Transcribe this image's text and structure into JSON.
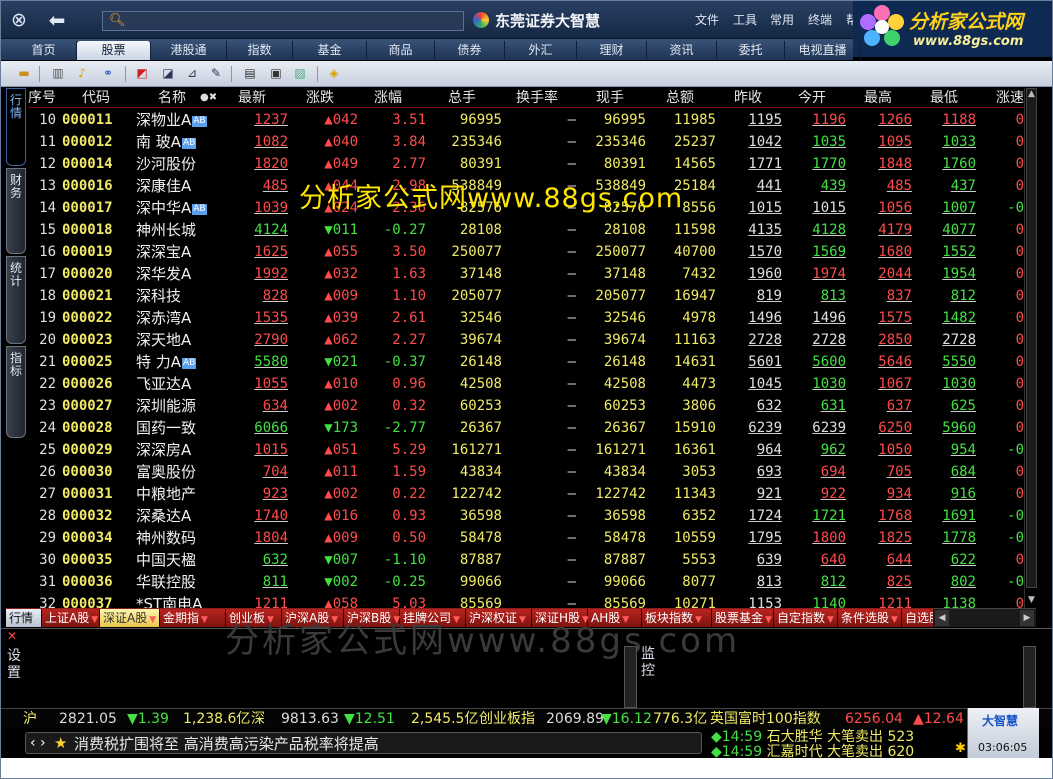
{
  "app": {
    "brand": "东莞证券大智慧",
    "search_placeholder": "",
    "menus": [
      "文件",
      "工具",
      "常用",
      "终端",
      "帮"
    ]
  },
  "watermark": {
    "logo_line1": "分析家公式网",
    "logo_line2": "www.88gs.com",
    "overlay": "分析家公式网www.88gs.com",
    "overlay2": "分析家公式网www.88gs.com"
  },
  "nav": [
    "首页",
    "股票",
    "港股通",
    "指数",
    "基金",
    "商品",
    "债券",
    "外汇",
    "理财",
    "资讯",
    "委托",
    "电视直播"
  ],
  "nav_active": 1,
  "toolbar_icons": [
    "folder-icon",
    "columns-icon",
    "bell-icon",
    "link-icon",
    "chart-icon",
    "line-chart-icon",
    "kline-icon",
    "pencil-chart-icon",
    "text-icon",
    "window-icon",
    "picture-icon",
    "help-icon"
  ],
  "left_tabs": [
    "行情",
    "财务",
    "统计",
    "指标"
  ],
  "columns": [
    "序号",
    "代码",
    "名称",
    "最新",
    "涨跌",
    "涨幅",
    "总手",
    "换手率",
    "现手",
    "总额",
    "昨收",
    "今开",
    "最高",
    "最低",
    "涨速"
  ],
  "rows": [
    {
      "no": "10",
      "code": "000011",
      "name": "深物业A",
      "ab": true,
      "last": "1237",
      "lc": "up",
      "chg": "▲042",
      "cc": "up",
      "pct": "3.51",
      "pc": "up",
      "vol": "96995",
      "turn": "–",
      "cur": "96995",
      "amt": "11985",
      "prev": "1195",
      "open": "1196",
      "oc": "up",
      "high": "1266",
      "hc": "up",
      "low": "1188",
      "lwc": "up",
      "spd": "0",
      "sc": "up"
    },
    {
      "no": "11",
      "code": "000012",
      "name": "南 玻A",
      "ab": true,
      "last": "1082",
      "lc": "up",
      "chg": "▲040",
      "cc": "up",
      "pct": "3.84",
      "pc": "up",
      "vol": "235346",
      "turn": "–",
      "cur": "235346",
      "amt": "25237",
      "prev": "1042",
      "open": "1035",
      "oc": "dn",
      "high": "1095",
      "hc": "up",
      "low": "1033",
      "lwc": "dn",
      "spd": "0",
      "sc": "up"
    },
    {
      "no": "12",
      "code": "000014",
      "name": "沙河股份",
      "ab": false,
      "last": "1820",
      "lc": "up",
      "chg": "▲049",
      "cc": "up",
      "pct": "2.77",
      "pc": "up",
      "vol": "80391",
      "turn": "–",
      "cur": "80391",
      "amt": "14565",
      "prev": "1771",
      "open": "1770",
      "oc": "dn",
      "high": "1848",
      "hc": "up",
      "low": "1760",
      "lwc": "dn",
      "spd": "0",
      "sc": "up"
    },
    {
      "no": "13",
      "code": "000016",
      "name": "深康佳A",
      "ab": false,
      "last": "485",
      "lc": "up",
      "chg": "▲044",
      "cc": "up",
      "pct": "2.98",
      "pc": "up",
      "vol": "538849",
      "turn": "–",
      "cur": "538849",
      "amt": "25184",
      "prev": "441",
      "open": "439",
      "oc": "dn",
      "high": "485",
      "hc": "up",
      "low": "437",
      "lwc": "dn",
      "spd": "0",
      "sc": "up"
    },
    {
      "no": "14",
      "code": "000017",
      "name": "深中华A",
      "ab": true,
      "last": "1039",
      "lc": "up",
      "chg": "▲024",
      "cc": "up",
      "pct": "2.36",
      "pc": "up",
      "vol": "82576",
      "turn": "–",
      "cur": "82576",
      "amt": "8556",
      "prev": "1015",
      "open": "1015",
      "oc": "eq",
      "high": "1056",
      "hc": "up",
      "low": "1007",
      "lwc": "dn",
      "spd": "-0",
      "sc": "dn"
    },
    {
      "no": "15",
      "code": "000018",
      "name": "神州长城",
      "ab": false,
      "last": "4124",
      "lc": "dn",
      "chg": "▼011",
      "cc": "dn",
      "pct": "-0.27",
      "pc": "dn",
      "vol": "28108",
      "turn": "–",
      "cur": "28108",
      "amt": "11598",
      "prev": "4135",
      "open": "4128",
      "oc": "dn",
      "high": "4179",
      "hc": "up",
      "low": "4077",
      "lwc": "dn",
      "spd": "0",
      "sc": "up"
    },
    {
      "no": "16",
      "code": "000019",
      "name": "深深宝A",
      "ab": false,
      "last": "1625",
      "lc": "up",
      "chg": "▲055",
      "cc": "up",
      "pct": "3.50",
      "pc": "up",
      "vol": "250077",
      "turn": "–",
      "cur": "250077",
      "amt": "40700",
      "prev": "1570",
      "open": "1569",
      "oc": "dn",
      "high": "1680",
      "hc": "up",
      "low": "1552",
      "lwc": "dn",
      "spd": "0",
      "sc": "up"
    },
    {
      "no": "17",
      "code": "000020",
      "name": "深华发A",
      "ab": false,
      "last": "1992",
      "lc": "up",
      "chg": "▲032",
      "cc": "up",
      "pct": "1.63",
      "pc": "up",
      "vol": "37148",
      "turn": "–",
      "cur": "37148",
      "amt": "7432",
      "prev": "1960",
      "open": "1974",
      "oc": "up",
      "high": "2044",
      "hc": "up",
      "low": "1954",
      "lwc": "dn",
      "spd": "0",
      "sc": "up"
    },
    {
      "no": "18",
      "code": "000021",
      "name": "深科技",
      "ab": false,
      "last": "828",
      "lc": "up",
      "chg": "▲009",
      "cc": "up",
      "pct": "1.10",
      "pc": "up",
      "vol": "205077",
      "turn": "–",
      "cur": "205077",
      "amt": "16947",
      "prev": "819",
      "open": "813",
      "oc": "dn",
      "high": "837",
      "hc": "up",
      "low": "812",
      "lwc": "dn",
      "spd": "0",
      "sc": "up"
    },
    {
      "no": "19",
      "code": "000022",
      "name": "深赤湾A",
      "ab": false,
      "last": "1535",
      "lc": "up",
      "chg": "▲039",
      "cc": "up",
      "pct": "2.61",
      "pc": "up",
      "vol": "32546",
      "turn": "–",
      "cur": "32546",
      "amt": "4978",
      "prev": "1496",
      "open": "1496",
      "oc": "eq",
      "high": "1575",
      "hc": "up",
      "low": "1482",
      "lwc": "dn",
      "spd": "0",
      "sc": "up"
    },
    {
      "no": "20",
      "code": "000023",
      "name": "深天地A",
      "ab": false,
      "last": "2790",
      "lc": "up",
      "chg": "▲062",
      "cc": "up",
      "pct": "2.27",
      "pc": "up",
      "vol": "39674",
      "turn": "–",
      "cur": "39674",
      "amt": "11163",
      "prev": "2728",
      "open": "2728",
      "oc": "eq",
      "high": "2850",
      "hc": "up",
      "low": "2728",
      "lwc": "eq",
      "spd": "0",
      "sc": "up"
    },
    {
      "no": "21",
      "code": "000025",
      "name": "特 力A",
      "ab": true,
      "last": "5580",
      "lc": "dn",
      "chg": "▼021",
      "cc": "dn",
      "pct": "-0.37",
      "pc": "dn",
      "vol": "26148",
      "turn": "–",
      "cur": "26148",
      "amt": "14631",
      "prev": "5601",
      "open": "5600",
      "oc": "dn",
      "high": "5646",
      "hc": "up",
      "low": "5550",
      "lwc": "dn",
      "spd": "0",
      "sc": "up"
    },
    {
      "no": "22",
      "code": "000026",
      "name": "飞亚达A",
      "ab": false,
      "last": "1055",
      "lc": "up",
      "chg": "▲010",
      "cc": "up",
      "pct": "0.96",
      "pc": "up",
      "vol": "42508",
      "turn": "–",
      "cur": "42508",
      "amt": "4473",
      "prev": "1045",
      "open": "1030",
      "oc": "dn",
      "high": "1067",
      "hc": "up",
      "low": "1030",
      "lwc": "dn",
      "spd": "0",
      "sc": "up"
    },
    {
      "no": "23",
      "code": "000027",
      "name": "深圳能源",
      "ab": false,
      "last": "634",
      "lc": "up",
      "chg": "▲002",
      "cc": "up",
      "pct": "0.32",
      "pc": "up",
      "vol": "60253",
      "turn": "–",
      "cur": "60253",
      "amt": "3806",
      "prev": "632",
      "open": "631",
      "oc": "dn",
      "high": "637",
      "hc": "up",
      "low": "625",
      "lwc": "dn",
      "spd": "0",
      "sc": "up"
    },
    {
      "no": "24",
      "code": "000028",
      "name": "国药一致",
      "ab": false,
      "last": "6066",
      "lc": "dn",
      "chg": "▼173",
      "cc": "dn",
      "pct": "-2.77",
      "pc": "dn",
      "vol": "26367",
      "turn": "–",
      "cur": "26367",
      "amt": "15910",
      "prev": "6239",
      "open": "6239",
      "oc": "eq",
      "high": "6250",
      "hc": "up",
      "low": "5960",
      "lwc": "dn",
      "spd": "0",
      "sc": "up"
    },
    {
      "no": "25",
      "code": "000029",
      "name": "深深房A",
      "ab": false,
      "last": "1015",
      "lc": "up",
      "chg": "▲051",
      "cc": "up",
      "pct": "5.29",
      "pc": "up",
      "vol": "161271",
      "turn": "–",
      "cur": "161271",
      "amt": "16361",
      "prev": "964",
      "open": "962",
      "oc": "dn",
      "high": "1050",
      "hc": "up",
      "low": "954",
      "lwc": "dn",
      "spd": "-0",
      "sc": "dn"
    },
    {
      "no": "26",
      "code": "000030",
      "name": "富奥股份",
      "ab": false,
      "last": "704",
      "lc": "up",
      "chg": "▲011",
      "cc": "up",
      "pct": "1.59",
      "pc": "up",
      "vol": "43834",
      "turn": "–",
      "cur": "43834",
      "amt": "3053",
      "prev": "693",
      "open": "694",
      "oc": "up",
      "high": "705",
      "hc": "up",
      "low": "684",
      "lwc": "dn",
      "spd": "0",
      "sc": "up"
    },
    {
      "no": "27",
      "code": "000031",
      "name": "中粮地产",
      "ab": false,
      "last": "923",
      "lc": "up",
      "chg": "▲002",
      "cc": "up",
      "pct": "0.22",
      "pc": "up",
      "vol": "122742",
      "turn": "–",
      "cur": "122742",
      "amt": "11343",
      "prev": "921",
      "open": "922",
      "oc": "up",
      "high": "934",
      "hc": "up",
      "low": "916",
      "lwc": "dn",
      "spd": "0",
      "sc": "up"
    },
    {
      "no": "28",
      "code": "000032",
      "name": "深桑达A",
      "ab": false,
      "last": "1740",
      "lc": "up",
      "chg": "▲016",
      "cc": "up",
      "pct": "0.93",
      "pc": "up",
      "vol": "36598",
      "turn": "–",
      "cur": "36598",
      "amt": "6352",
      "prev": "1724",
      "open": "1721",
      "oc": "dn",
      "high": "1768",
      "hc": "up",
      "low": "1691",
      "lwc": "dn",
      "spd": "-0",
      "sc": "dn"
    },
    {
      "no": "29",
      "code": "000034",
      "name": "神州数码",
      "ab": false,
      "last": "1804",
      "lc": "up",
      "chg": "▲009",
      "cc": "up",
      "pct": "0.50",
      "pc": "up",
      "vol": "58478",
      "turn": "–",
      "cur": "58478",
      "amt": "10559",
      "prev": "1795",
      "open": "1800",
      "oc": "up",
      "high": "1825",
      "hc": "up",
      "low": "1778",
      "lwc": "dn",
      "spd": "-0",
      "sc": "dn"
    },
    {
      "no": "30",
      "code": "000035",
      "name": "中国天楹",
      "ab": false,
      "last": "632",
      "lc": "dn",
      "chg": "▼007",
      "cc": "dn",
      "pct": "-1.10",
      "pc": "dn",
      "vol": "87887",
      "turn": "–",
      "cur": "87887",
      "amt": "5553",
      "prev": "639",
      "open": "640",
      "oc": "up",
      "high": "644",
      "hc": "up",
      "low": "622",
      "lwc": "dn",
      "spd": "0",
      "sc": "up"
    },
    {
      "no": "31",
      "code": "000036",
      "name": "华联控股",
      "ab": false,
      "last": "811",
      "lc": "dn",
      "chg": "▼002",
      "cc": "dn",
      "pct": "-0.25",
      "pc": "dn",
      "vol": "99066",
      "turn": "–",
      "cur": "99066",
      "amt": "8077",
      "prev": "813",
      "open": "812",
      "oc": "dn",
      "high": "825",
      "hc": "up",
      "low": "802",
      "lwc": "dn",
      "spd": "-0",
      "sc": "dn"
    },
    {
      "no": "32",
      "code": "000037",
      "name": "*ST南电A",
      "ab": false,
      "last": "1211",
      "lc": "up",
      "chg": "▲058",
      "cc": "up",
      "pct": "5.03",
      "pc": "up",
      "vol": "85569",
      "turn": "–",
      "cur": "85569",
      "amt": "10271",
      "prev": "1153",
      "open": "1140",
      "oc": "dn",
      "high": "1211",
      "hc": "up",
      "low": "1138",
      "lwc": "dn",
      "spd": "0",
      "sc": "up"
    }
  ],
  "bottom_tabs": [
    "行情",
    "上证A股",
    "深证A股",
    "金期指",
    "创业板",
    "沪深A股",
    "沪深B股",
    "挂牌公司",
    "沪深权证",
    "深证H股",
    "AH股",
    "板块指数",
    "股票基金",
    "自定指数",
    "条件选股",
    "自选股"
  ],
  "bottom_active": 2,
  "panels": {
    "settings": "设置",
    "monitor": "监控"
  },
  "ticker": {
    "sh_label": "沪",
    "sh_index": "2821.05",
    "sh_chg": "▼1.39",
    "sh_amt": "1,238.6亿",
    "sz_label": "深",
    "sz_index": "9813.63",
    "sz_chg": "▼12.51",
    "sz_amt": "2,545.5亿",
    "cyb_label": "创业板指",
    "cyb_index": "2069.89",
    "cyb_chg": "▼16.12",
    "cyb_amt": "776.3亿",
    "ftse_label": "英国富时100指数",
    "ftse_index": "6256.04",
    "ftse_chg": "▲12.64"
  },
  "news": {
    "nav": "‹ ›",
    "text": "消费税扩围将至 高消费高污染产品税率将提高"
  },
  "alerts": [
    {
      "time": "◆14:59",
      "name": "石大胜华",
      "action": "大笔卖出",
      "value": "523"
    },
    {
      "time": "◆14:59",
      "name": "汇嘉时代",
      "action": "大笔卖出",
      "value": "620"
    }
  ],
  "clock": {
    "logo": "大智慧",
    "time": "03:06:05"
  },
  "colors": {
    "up": "#ff4b4b",
    "down": "#44e044",
    "code": "#f0ea66",
    "header_line": "#7a1010"
  }
}
